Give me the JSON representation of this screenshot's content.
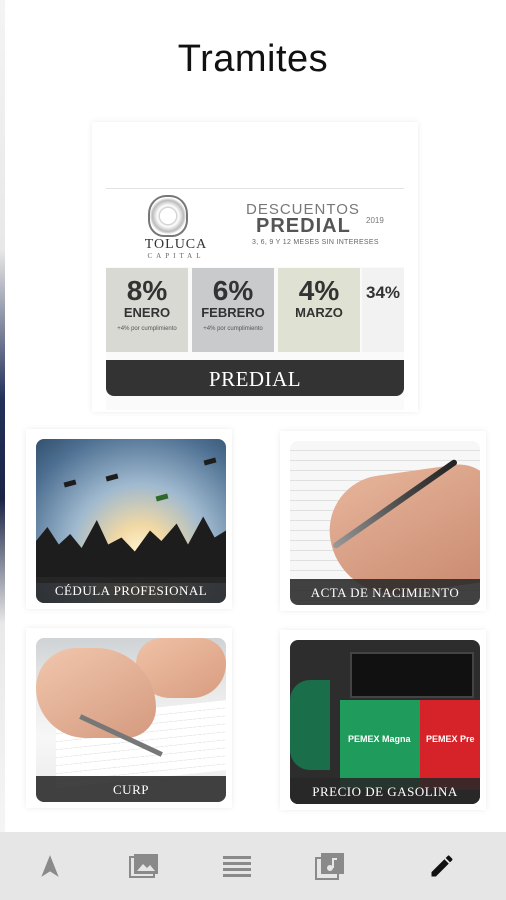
{
  "page": {
    "title": "Tramites"
  },
  "predial_card": {
    "logo_text": "TOLUCA",
    "logo_subtext": "CAPITAL",
    "descuentos": "DESCUENTOS",
    "predial": "PREDIAL",
    "year": "2019",
    "meses": "3, 6, 9 Y 12 MESES SIN INTERESES",
    "discounts": [
      {
        "pct": "8%",
        "month": "ENERO",
        "note": "+4% por cumplimiento"
      },
      {
        "pct": "6%",
        "month": "FEBRERO",
        "note": "+4% por cumplimiento"
      },
      {
        "pct": "4%",
        "month": "MARZO",
        "note": ""
      },
      {
        "pct": "34%",
        "month": "",
        "note": ""
      }
    ],
    "label": "PREDIAL"
  },
  "tiles": [
    {
      "label": "CÉDULA PROFESIONAL"
    },
    {
      "label": "ACTA DE NACIMIENTO"
    },
    {
      "label": "CURP"
    },
    {
      "label": "PRECIO DE GASOLINA"
    }
  ],
  "gas_pump": {
    "brand_green": "PEMEX Magna",
    "brand_red": "PEMEX Pre"
  },
  "bottom_nav": {
    "items": [
      {
        "icon": "navigation-arrow-icon",
        "active": false
      },
      {
        "icon": "image-gallery-icon",
        "active": false
      },
      {
        "icon": "list-icon",
        "active": false
      },
      {
        "icon": "music-library-icon",
        "active": false
      },
      {
        "icon": "pencil-icon",
        "active": true
      }
    ],
    "active_color": "#111111",
    "inactive_color": "#8a8a8a",
    "background": "#e6e6e6"
  }
}
